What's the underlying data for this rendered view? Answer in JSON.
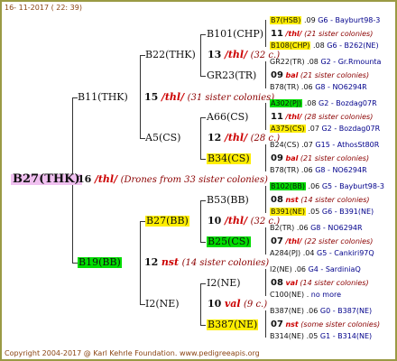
{
  "header": {
    "date": "16- 11-2017 ( 22: 39)"
  },
  "footer": {
    "copyright": "Copyright 2004-2017 @ Karl Kehrle Foundation.   www.pedigreeapis.org"
  },
  "root": {
    "name": "B27(THK)"
  },
  "gen1": {
    "num": "16",
    "breeder": "/thl/",
    "note": "(Drones from 33 sister colonies)"
  },
  "sire": {
    "name": "B11(THK)",
    "num": "15",
    "breeder": "/thl/",
    "note": "(31 sister colonies)"
  },
  "dam": {
    "name": "B19(BB)",
    "num": "12",
    "breeder": "nst",
    "note": "(14 sister colonies)"
  },
  "sire_sire": {
    "name": "B22(THK)",
    "num": "13",
    "breeder": "/thl/",
    "note": "(32 c.)"
  },
  "sire_dam": {
    "name": "A5(CS)",
    "num": "12",
    "breeder": "/thl/",
    "note": "(28 c.)"
  },
  "dam_sire": {
    "name": "B27(BB)",
    "num": "10",
    "breeder": "/thl/",
    "note": "(32 c.)"
  },
  "dam_dam": {
    "name": "I2(NE)",
    "num": "10",
    "breeder": "val",
    "note": "(9 c.)"
  },
  "ss_s": {
    "name": "B101(CHP)",
    "num": "11",
    "breeder": "/thl/",
    "note": "(21 sister colonies)"
  },
  "ss_d": {
    "name": "GR23(TR)",
    "num": "09",
    "breeder": "bal",
    "note": "(21 sister colonies)"
  },
  "sd_s": {
    "name": "A66(CS)",
    "num": "11",
    "breeder": "/thl/",
    "note": "(28 sister colonies)"
  },
  "sd_d": {
    "name": "B34(CS)",
    "num": "09",
    "breeder": "bal",
    "note": "(21 sister colonies)"
  },
  "ds_s": {
    "name": "B53(BB)",
    "num": "08",
    "breeder": "nst",
    "note": "(14 sister colonies)"
  },
  "ds_d": {
    "name": "B25(CS)",
    "num": "07",
    "breeder": "/thl/",
    "note": "(22 sister colonies)"
  },
  "dd_s": {
    "name": "I2(NE)",
    "num": "08",
    "breeder": "val",
    "note": "(14 sister colonies)"
  },
  "dd_d": {
    "name": "B387(NE)",
    "num": "07",
    "breeder": "nst",
    "note": "(some sister colonies)"
  },
  "g4": [
    {
      "name": "B7(HSB)",
      "score": ".09",
      "ref": "G6 - Bayburt98-3"
    },
    {
      "name": "B108(CHP)",
      "score": ".08",
      "ref": "G6 - B262(NE)"
    },
    {
      "name": "GR22(TR)",
      "score": ".08",
      "ref": "G2 - Gr.Rmounta"
    },
    {
      "name": "B78(TR)",
      "score": ".06",
      "ref": "G8 - NO6294R"
    },
    {
      "name": "A302(PJ)",
      "score": ".08",
      "ref": "G2 - Bozdag07R"
    },
    {
      "name": "A375(CS)",
      "score": ".07",
      "ref": "G2 - Bozdag07R"
    },
    {
      "name": "B24(CS)",
      "score": ".07",
      "ref": "G15 - AthosSt80R"
    },
    {
      "name": "B78(TR)",
      "score": ".06",
      "ref": "G8 - NO6294R"
    },
    {
      "name": "B102(BB)",
      "score": ".06",
      "ref": "G5 - Bayburt98-3"
    },
    {
      "name": "B391(NE)",
      "score": ".05",
      "ref": "G6 - B391(NE)"
    },
    {
      "name": "B2(TR)",
      "score": ".06",
      "ref": "G8 - NO6294R"
    },
    {
      "name": "A284(PJ)",
      "score": ".04",
      "ref": "G5 - Cankiri97Q"
    },
    {
      "name": "I2(NE)",
      "score": ".06",
      "ref": "G4 - SardiniaQ"
    },
    {
      "name": "C100(NE)",
      "score": ".",
      "ref": "no more"
    },
    {
      "name": "B387(NE)",
      "score": ".06",
      "ref": "G0 - B387(NE)"
    },
    {
      "name": "B314(NE)",
      "score": ".05",
      "ref": "G1 - B314(NE)"
    }
  ]
}
